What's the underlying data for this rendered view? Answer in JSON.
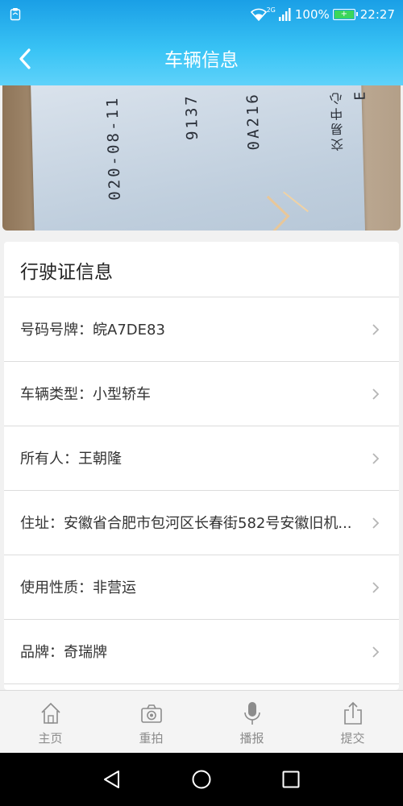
{
  "status_bar": {
    "network": "2G",
    "battery": "100%",
    "time": "22:27",
    "battery_color": "#3bd65b"
  },
  "header": {
    "title": "车辆信息",
    "back_icon": "chevron-left-icon",
    "background": "#1a9fe6"
  },
  "photo": {
    "card_lines": [
      "E",
      "交易中心",
      "0A216",
      "9137",
      "020-08-11"
    ]
  },
  "license_section": {
    "title": "行驶证信息",
    "rows": [
      {
        "label": "号码号牌",
        "sep": "：",
        "value": "皖A7DE83"
      },
      {
        "label": "车辆类型",
        "sep": "：",
        "value": "小型轿车"
      },
      {
        "label": "所有人",
        "sep": "：",
        "value": "王朝隆"
      },
      {
        "label": "住址",
        "sep": "：",
        "value": "安徽省合肥市包河区长春街582号安徽旧机..."
      },
      {
        "label": "使用性质",
        "sep": "：",
        "value": "非营运"
      },
      {
        "label": "品牌",
        "sep": "：",
        "value": "奇瑞牌"
      }
    ]
  },
  "tabbar": {
    "items": [
      {
        "label": "主页",
        "icon": "home-icon"
      },
      {
        "label": "重拍",
        "icon": "camera-icon"
      },
      {
        "label": "播报",
        "icon": "microphone-icon"
      },
      {
        "label": "提交",
        "icon": "share-upload-icon"
      }
    ]
  },
  "system_nav": {
    "buttons": [
      "back-triangle-icon",
      "home-circle-icon",
      "recents-square-icon"
    ]
  }
}
